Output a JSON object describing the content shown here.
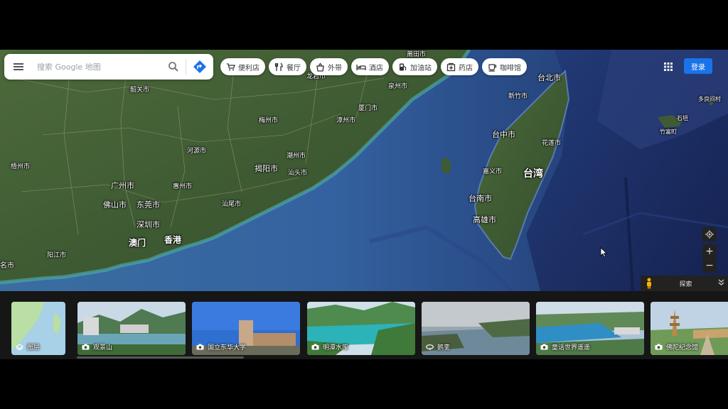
{
  "search": {
    "placeholder": "搜索 Google 地图"
  },
  "chips": [
    {
      "label": "便利店",
      "icon": "shopping-cart-icon"
    },
    {
      "label": "餐厅",
      "icon": "restaurant-icon"
    },
    {
      "label": "外带",
      "icon": "takeout-icon"
    },
    {
      "label": "酒店",
      "icon": "hotel-bed-icon"
    },
    {
      "label": "加油站",
      "icon": "gas-station-icon"
    },
    {
      "label": "药店",
      "icon": "pharmacy-icon"
    },
    {
      "label": "咖啡馆",
      "icon": "coffee-cup-icon"
    }
  ],
  "header": {
    "login_label": "登录"
  },
  "map_labels": {
    "putian": "莆田市",
    "longyan": "龙岩市",
    "quanzhou": "泉州市",
    "shaoguan": "韶关市",
    "zhangzhou": "漳州市",
    "xiamen": "厦门市",
    "meizhou": "梅州市",
    "heyuan": "河源市",
    "chaozhou": "潮州市",
    "jieyang": "揭阳市",
    "shantou": "汕头市",
    "wuzhou": "梧州市",
    "guangzhou": "广州市",
    "foshan": "佛山市",
    "dongguan": "东莞市",
    "huizhou": "惠州市",
    "shanwei": "汕尾市",
    "shenzhen": "深圳市",
    "macau": "澳门",
    "hongkong": "香港",
    "yangjiang": "阳江市",
    "mingshi": "名市",
    "taipei": "台北市",
    "hsinchu": "新竹市",
    "taichung": "台中市",
    "hualien": "花莲市",
    "chiayi": "嘉义市",
    "taiwan": "台湾",
    "tainan": "台南市",
    "kaohsiung": "高雄市",
    "taramashi": "多良间村",
    "ishigaki": "石垣",
    "taketomi": "竹富町"
  },
  "controls": {
    "explore_label": "探索"
  },
  "strip": {
    "layers_label": "图层",
    "cards": [
      {
        "label": "观景山",
        "icon": "camera-icon"
      },
      {
        "label": "国立东华大学",
        "icon": "camera-icon"
      },
      {
        "label": "明潭水库",
        "icon": "camera-icon"
      },
      {
        "label": "鹅銮",
        "icon": "panorama-360-icon"
      },
      {
        "label": "童话世界遥遥",
        "icon": "camera-icon"
      },
      {
        "label": "佛陀纪念馆",
        "icon": "camera-icon"
      }
    ]
  }
}
